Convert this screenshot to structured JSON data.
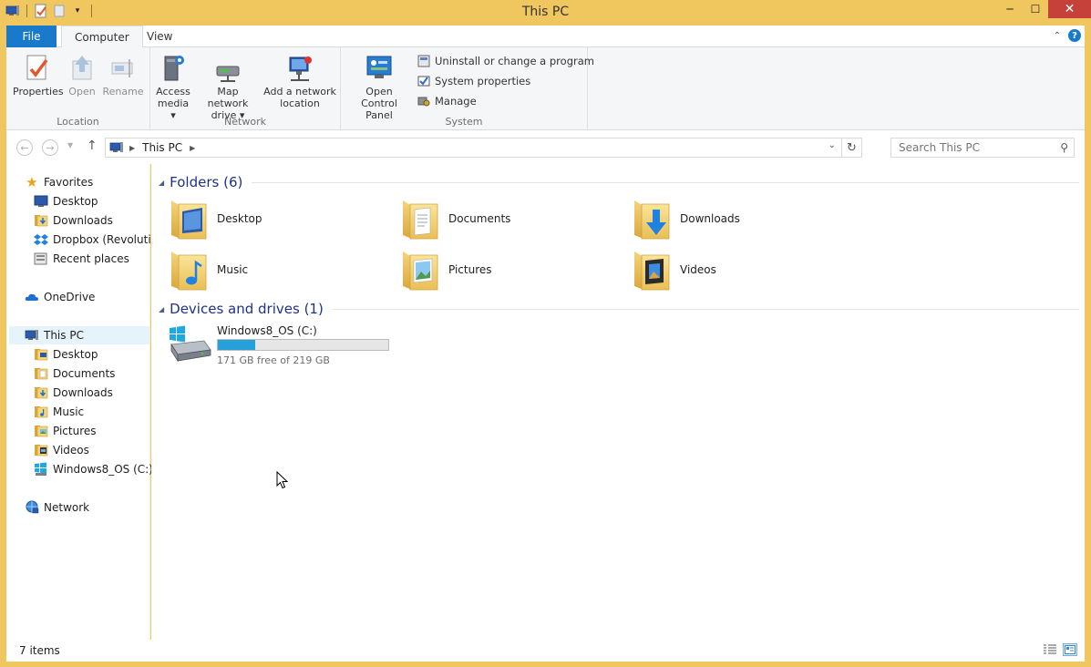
{
  "window": {
    "title": "This PC",
    "controls": {
      "minimize": "─",
      "maximize": "☐",
      "close": "✕"
    }
  },
  "ribbon": {
    "tabs": {
      "file": "File",
      "computer": "Computer",
      "view": "View"
    },
    "help": "?",
    "groups": {
      "location": {
        "label": "Location",
        "properties": "Properties",
        "open": "Open",
        "rename": "Rename"
      },
      "network": {
        "label": "Network",
        "access_media": [
          "Access",
          "media ▾"
        ],
        "map_network_drive": [
          "Map network",
          "drive ▾"
        ],
        "add_network_location": [
          "Add a network",
          "location"
        ]
      },
      "system": {
        "label": "System",
        "open_control_panel": [
          "Open Control",
          "Panel"
        ],
        "uninstall": "Uninstall or change a program",
        "system_properties": "System properties",
        "manage": "Manage"
      }
    }
  },
  "address": {
    "crumb": "This PC",
    "search_placeholder": "Search This PC"
  },
  "nav": {
    "favorites": "Favorites",
    "favorites_items": [
      "Desktop",
      "Downloads",
      "Dropbox (Revolution",
      "Recent places"
    ],
    "onedrive": "OneDrive",
    "this_pc": "This PC",
    "this_pc_items": [
      "Desktop",
      "Documents",
      "Downloads",
      "Music",
      "Pictures",
      "Videos",
      "Windows8_OS (C:)"
    ],
    "network": "Network"
  },
  "content": {
    "folders_header": "Folders (6)",
    "folders": [
      "Desktop",
      "Documents",
      "Downloads",
      "Music",
      "Pictures",
      "Videos"
    ],
    "devices_header": "Devices and drives (1)",
    "drive": {
      "name": "Windows8_OS (C:)",
      "free_text": "171 GB free of 219 GB",
      "used_fraction": 0.22,
      "bar_color": "#26a0da"
    }
  },
  "status": {
    "items": "7 items"
  },
  "colors": {
    "frame": "#f0c75e",
    "file_tab": "#1979ca",
    "close_button": "#c7413b",
    "section_header": "#1e3287"
  }
}
